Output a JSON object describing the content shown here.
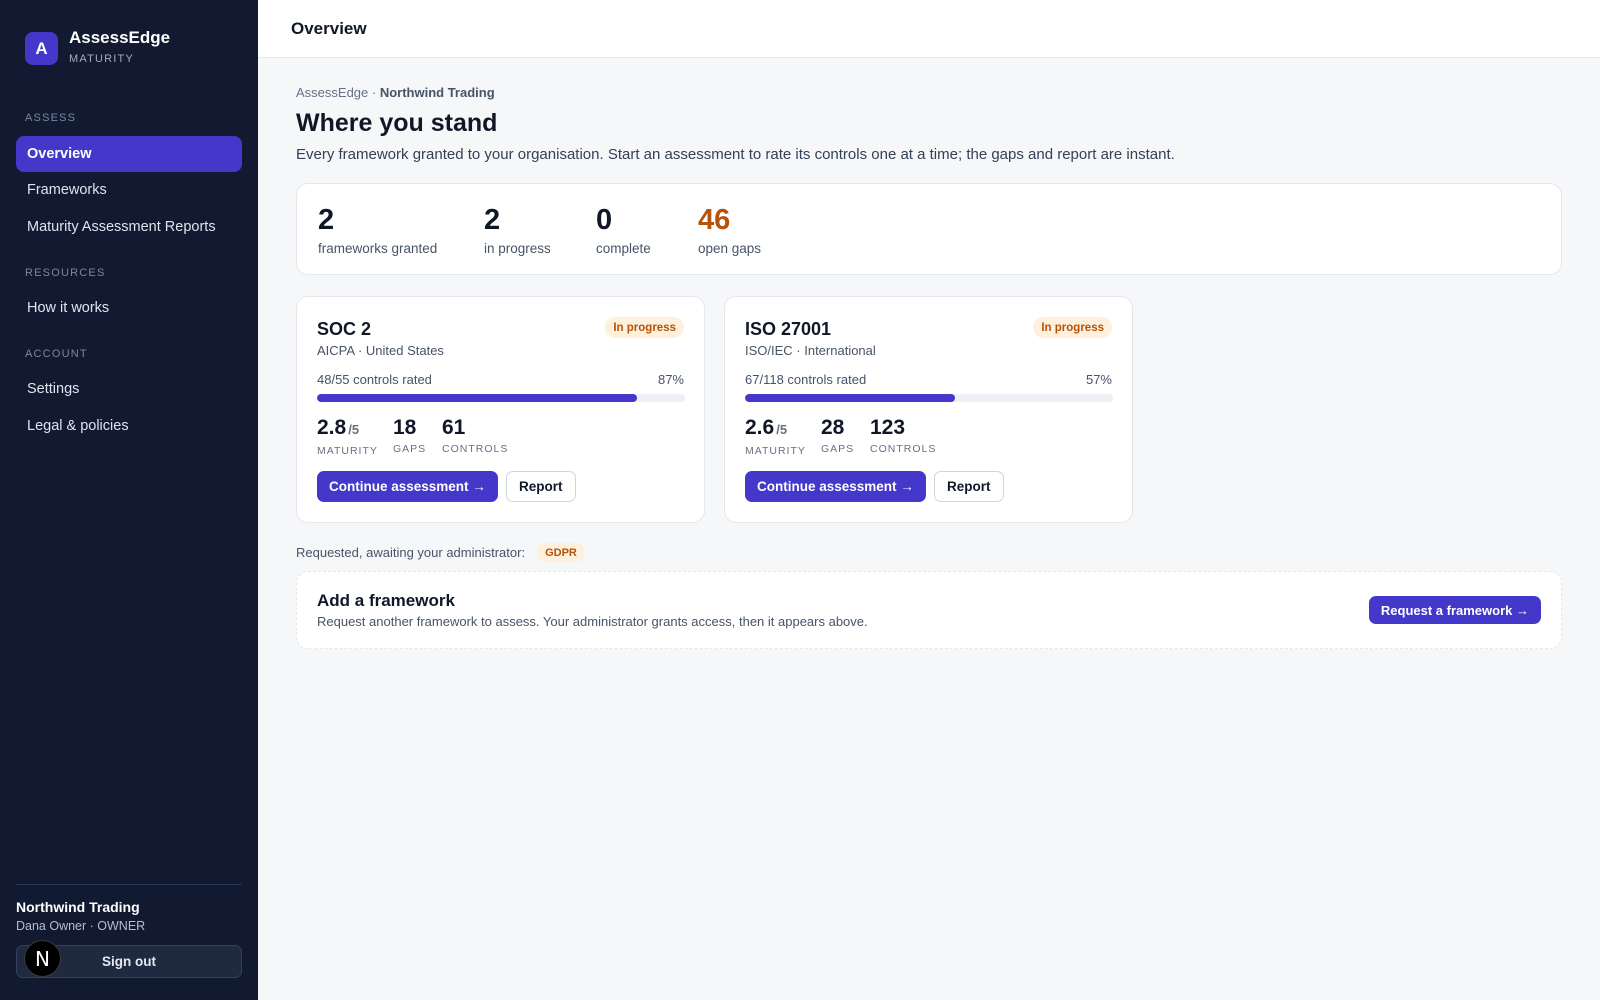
{
  "brand": {
    "logo_letter": "A",
    "name": "AssessEdge",
    "subtitle": "MATURITY"
  },
  "sidebar": {
    "sections": [
      {
        "label": "ASSESS"
      },
      {
        "label": "RESOURCES"
      },
      {
        "label": "ACCOUNT"
      }
    ],
    "items": [
      {
        "label": "Overview",
        "active": true
      },
      {
        "label": "Frameworks"
      },
      {
        "label": "Maturity Assessment Reports"
      },
      {
        "label": "How it works"
      },
      {
        "label": "Settings"
      },
      {
        "label": "Legal & policies"
      }
    ],
    "org_name": "Northwind Trading",
    "org_user": "Dana Owner · OWNER",
    "sign_out_label": "Sign out",
    "avatar_letter": "N"
  },
  "header": {
    "title": "Overview"
  },
  "main": {
    "breadcrumb_root": "AssessEdge · ",
    "breadcrumb_org": "Northwind Trading",
    "title": "Where you stand",
    "description": "Every framework granted to your organisation. Start an assessment to rate its controls one at a time; the gaps and report are instant.",
    "stats": [
      {
        "value": "2",
        "label": "frameworks granted"
      },
      {
        "value": "2",
        "label": "in progress"
      },
      {
        "value": "0",
        "label": "complete"
      },
      {
        "value": "46",
        "label": "open gaps",
        "color": "#b45309"
      }
    ],
    "frameworks": [
      {
        "name": "SOC 2",
        "org": "AICPA · United States",
        "status": "In progress",
        "controls_rated_text": "48/55 controls rated",
        "percent_text": "87%",
        "progress": 0.87,
        "maturity": "2.8",
        "maturity_max": "/5",
        "maturity_label": "MATURITY",
        "gaps": "18",
        "gaps_label": "GAPS",
        "controls": "61",
        "controls_label": "CONTROLS",
        "continue_label": "Continue assessment →",
        "report_label": "Report"
      },
      {
        "name": "ISO 27001",
        "org": "ISO/IEC · International",
        "status": "In progress",
        "controls_rated_text": "67/118 controls rated",
        "percent_text": "57%",
        "progress": 0.57,
        "maturity": "2.6",
        "maturity_max": "/5",
        "maturity_label": "MATURITY",
        "gaps": "28",
        "gaps_label": "GAPS",
        "controls": "123",
        "controls_label": "CONTROLS",
        "continue_label": "Continue assessment →",
        "report_label": "Report"
      }
    ],
    "requested_label": "Requested, awaiting your administrator:",
    "requested_items": [
      "GDPR"
    ],
    "add_framework": {
      "title": "Add a framework",
      "description": "Request another framework to assess. Your administrator grants access, then it appears above.",
      "button_label": "Request a framework →"
    }
  },
  "colors": {
    "accent": "#4338ca",
    "sidebar_bg": "#111a30",
    "warning": "#b45309",
    "badge_bg": "#fdf0dc"
  }
}
